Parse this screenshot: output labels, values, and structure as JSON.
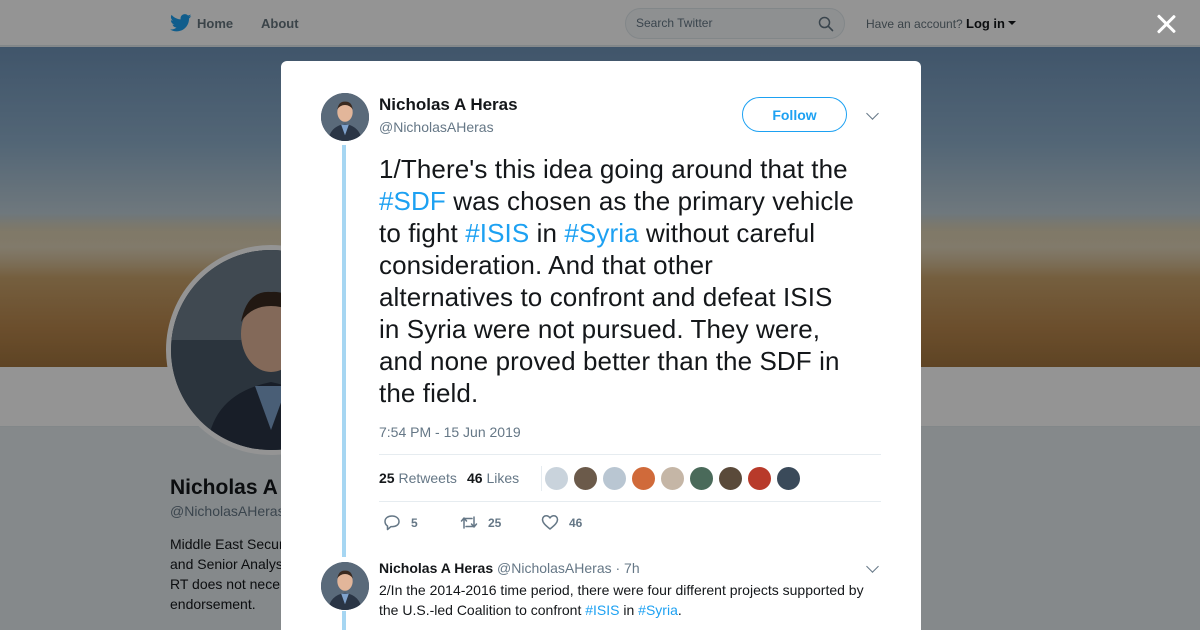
{
  "nav": {
    "home_label": "Home",
    "about_label": "About",
    "search_placeholder": "Search Twitter",
    "have_account_text": "Have an account?",
    "login_label": "Log in"
  },
  "background_profile": {
    "name": "Nicholas A",
    "handle": "@NicholasAHeras",
    "bio_lines": [
      "Middle East Secur",
      "and Senior Analys",
      "RT does not nece",
      "endorsement."
    ]
  },
  "tweet": {
    "author_name": "Nicholas A Heras",
    "author_handle": "@NicholasAHeras",
    "follow_label": "Follow",
    "text": {
      "l1": "1/There's this idea going around that the",
      "l2_tag": "#SDF",
      "l2_rest": " was chosen as the primary vehicle",
      "l3_a": "to fight ",
      "l3_tag1": "#ISIS",
      "l3_b": " in ",
      "l3_tag2": "#Syria",
      "l3_c": " without careful",
      "l4": "consideration. And that other",
      "l5": "alternatives to confront and defeat ISIS",
      "l6": "in Syria were not pursued. They were,",
      "l7": "and none proved better than the SDF in",
      "l8": "the field."
    },
    "timestamp": "7:54 PM - 15 Jun 2019",
    "retweets_count": "25",
    "retweets_label": "Retweets",
    "likes_count": "46",
    "likes_label": "Likes",
    "likers_colors": [
      "#c9d3dc",
      "#6b5a4a",
      "#b9c6d2",
      "#d06a3a",
      "#c5b6a6",
      "#4a6a5a",
      "#5a4a3a",
      "#b83a2a",
      "#3a4a5a"
    ],
    "reply_count": "5",
    "retweet_count_action": "25",
    "like_count_action": "46"
  },
  "reply": {
    "author_name": "Nicholas A Heras",
    "author_handle": "@NicholasAHeras",
    "time": "· 7h",
    "line1": "2/In the 2014-2016 time period, there were four different projects supported by",
    "line2_a": "the U.S.-led Coalition to confront ",
    "line2_tag1": "#ISIS",
    "line2_b": " in ",
    "line2_tag2": "#Syria",
    "line2_c": "."
  }
}
